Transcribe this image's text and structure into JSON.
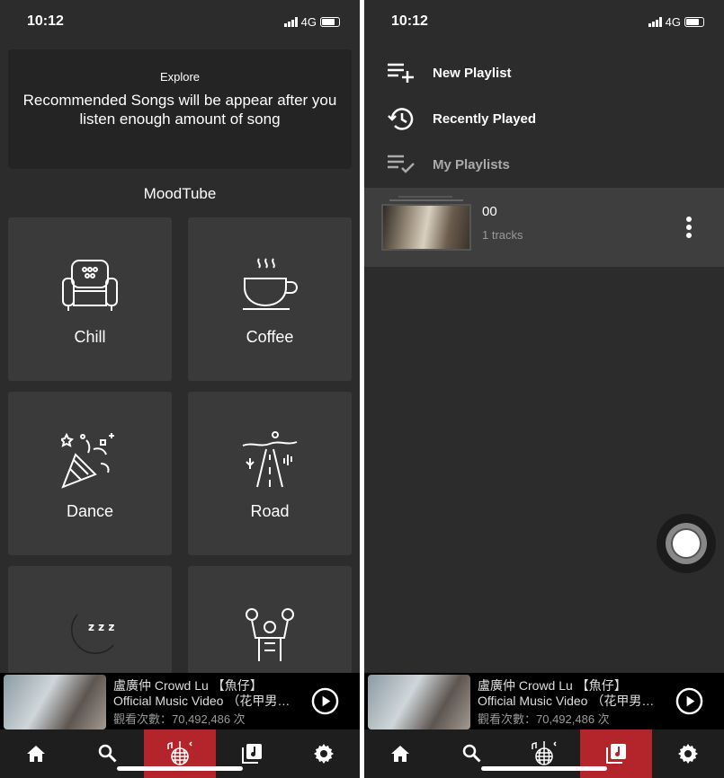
{
  "status": {
    "time": "10:12",
    "network": "4G"
  },
  "left": {
    "explore": {
      "title": "Explore",
      "message": "Recommended Songs will be appear after you listen enough amount of song"
    },
    "section_title": "MoodTube",
    "moods": [
      {
        "label": "Chill",
        "icon": "armchair-icon"
      },
      {
        "label": "Coffee",
        "icon": "coffee-cup-icon"
      },
      {
        "label": "Dance",
        "icon": "party-popper-icon"
      },
      {
        "label": "Road",
        "icon": "road-icon"
      },
      {
        "label": "",
        "icon": "moon-sleep-icon"
      },
      {
        "label": "",
        "icon": "muscle-man-icon"
      }
    ]
  },
  "right": {
    "menu": [
      {
        "label": "New Playlist",
        "icon": "playlist-add-icon"
      },
      {
        "label": "Recently Played",
        "icon": "history-icon"
      },
      {
        "label": "My Playlists",
        "icon": "playlist-check-icon"
      }
    ],
    "playlists": [
      {
        "name": "00",
        "count": "1 tracks"
      }
    ]
  },
  "mini_player": {
    "line1": "盧廣仲 Crowd Lu 【魚仔】",
    "line2": "Official Music Video （花甲男…",
    "views": "觀看次數：70,492,486 次"
  },
  "tabs": [
    {
      "icon": "home-icon"
    },
    {
      "icon": "search-icon"
    },
    {
      "icon": "disco-ball-icon"
    },
    {
      "icon": "music-library-icon"
    },
    {
      "icon": "gear-icon"
    }
  ],
  "colors": {
    "accent": "#b3252a",
    "background": "#2c2c2c",
    "tile": "#3a3a3a"
  }
}
